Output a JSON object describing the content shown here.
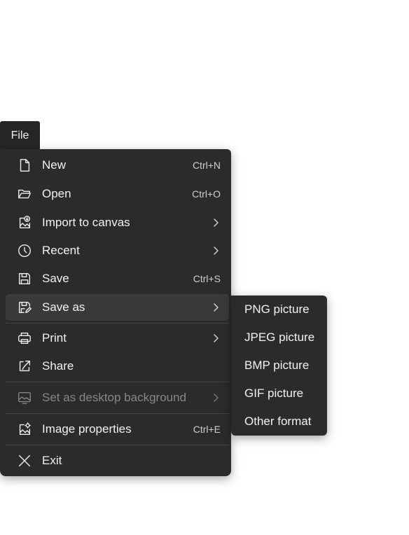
{
  "file_tab": {
    "label": "File"
  },
  "menu": {
    "items": [
      {
        "label": "New",
        "icon": "new-file-icon",
        "shortcut": "Ctrl+N"
      },
      {
        "label": "Open",
        "icon": "folder-open-icon",
        "shortcut": "Ctrl+O"
      },
      {
        "label": "Import to canvas",
        "icon": "import-image-icon",
        "submenu": true
      },
      {
        "label": "Recent",
        "icon": "clock-icon",
        "submenu": true
      },
      {
        "label": "Save",
        "icon": "save-icon",
        "shortcut": "Ctrl+S"
      },
      {
        "label": "Save as",
        "icon": "save-as-icon",
        "submenu": true,
        "state": "highlighted"
      },
      {
        "label": "Print",
        "icon": "printer-icon",
        "submenu": true
      },
      {
        "label": "Share",
        "icon": "share-icon"
      },
      {
        "label": "Set as desktop background",
        "icon": "desktop-background-icon",
        "submenu": true,
        "state": "disabled"
      },
      {
        "label": "Image properties",
        "icon": "image-properties-icon",
        "shortcut": "Ctrl+E"
      },
      {
        "label": "Exit",
        "icon": "close-icon"
      }
    ]
  },
  "save_as_submenu": {
    "items": [
      {
        "label": "PNG picture"
      },
      {
        "label": "JPEG picture"
      },
      {
        "label": "BMP picture"
      },
      {
        "label": "GIF picture"
      },
      {
        "label": "Other format"
      }
    ]
  },
  "colors": {
    "menu_background": "#2b2b2b",
    "highlight": "#3a3a3a",
    "text": "#f2f2f2"
  }
}
